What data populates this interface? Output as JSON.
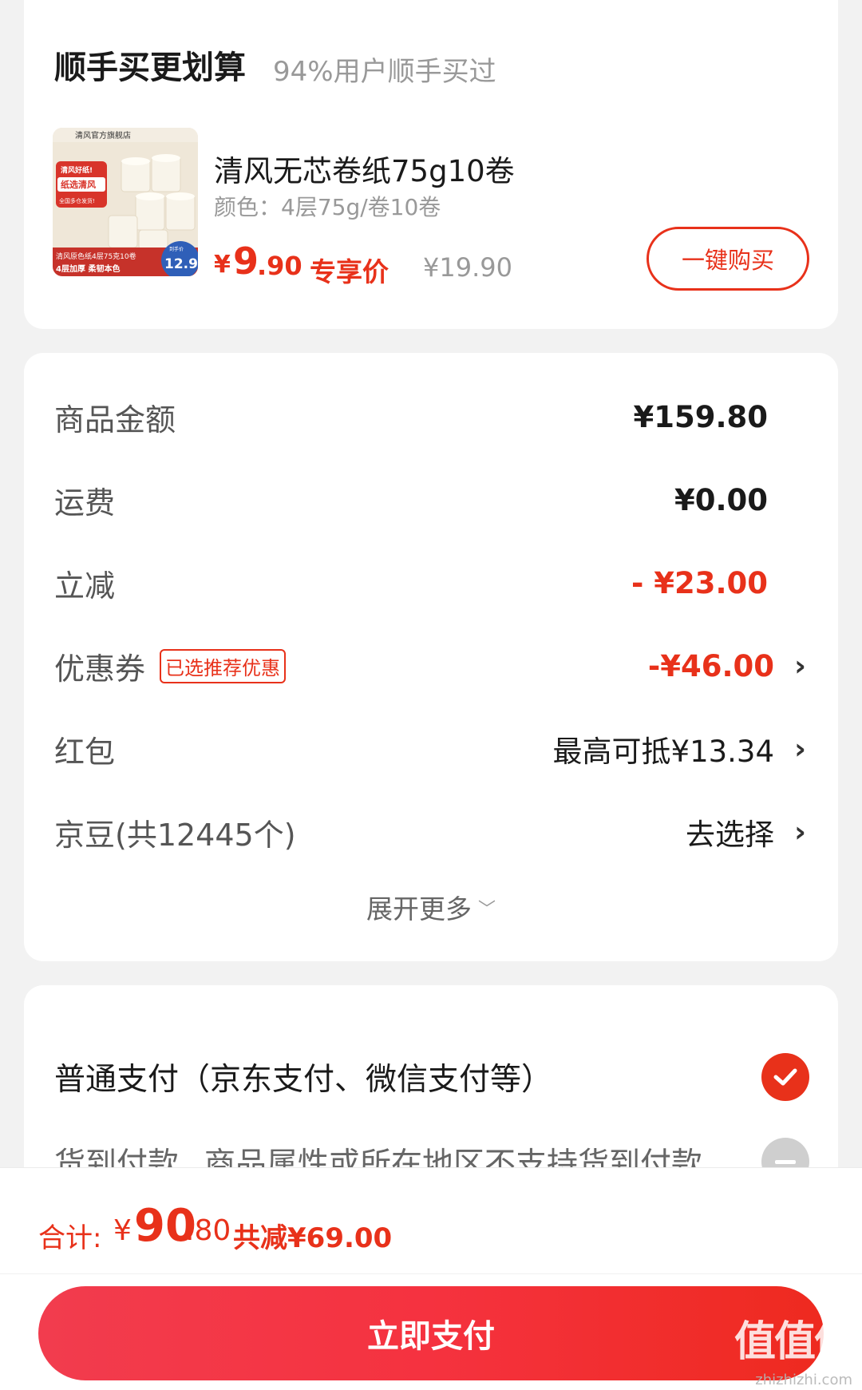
{
  "upsell": {
    "title": "顺手买更划算",
    "subtitle": "94%用户顺手买过",
    "product": {
      "name": "清风无芯卷纸75g10卷",
      "spec": "颜色：4层75g/卷10卷",
      "price_yen": "¥",
      "price_int": "9",
      "price_dec": ".90",
      "price_tag": "专享价",
      "original_price": "¥19.90",
      "buy_label": "一键购买",
      "image_texts": [
        "清风官方旗舰店",
        "清风好纸!",
        "纸选清风",
        "全国多仓发货!",
        "清风原色纸4层75克10卷",
        "4层加厚 柔韧本色",
        "到手价",
        "12.9"
      ]
    }
  },
  "summary": {
    "goods_label": "商品金额",
    "goods_value": "¥159.80",
    "shipping_label": "运费",
    "shipping_value": "¥0.00",
    "discount_label": "立减",
    "discount_value": "- ¥23.00",
    "coupon_label": "优惠券",
    "coupon_badge": "已选推荐优惠",
    "coupon_value": "-¥46.00",
    "redpacket_label": "红包",
    "redpacket_value": "最高可抵¥13.34",
    "jingdou_label": "京豆(共12445个)",
    "jingdou_value": "去选择",
    "expand_label": "展开更多",
    "arrow": "›"
  },
  "payment": {
    "normal_label": "普通支付（京东支付、微信支付等）",
    "cod_label": "货到付款",
    "cod_note": "商品属性或所在地区不支持货到付款"
  },
  "footer": {
    "total_label": "合计:",
    "total_yen": "¥",
    "total_int": "90",
    "total_dec": ".80",
    "total_saved": "共减¥69.00",
    "pay_button": "立即支付",
    "watermark": "值值值",
    "watermark_url": "zhizhizhi.com"
  },
  "colors": {
    "accent": "#e8311a",
    "button_gradient_start": "#f23c4e",
    "button_gradient_end": "#ee2a1f"
  }
}
